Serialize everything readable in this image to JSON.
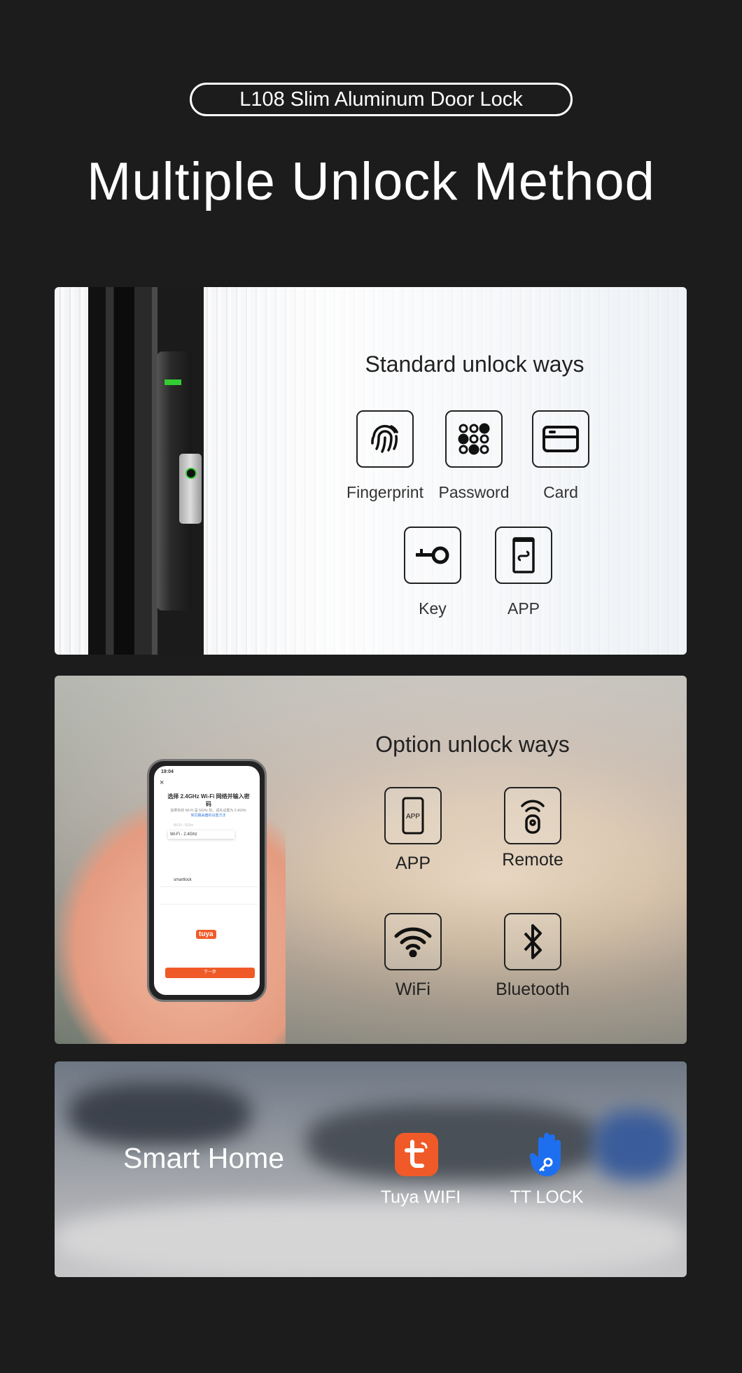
{
  "header": {
    "badge": "L108 Slim Aluminum Door Lock",
    "title": "Multiple Unlock Method"
  },
  "standard": {
    "heading": "Standard unlock ways",
    "items": [
      {
        "label": "Fingerprint",
        "icon": "fingerprint-icon"
      },
      {
        "label": "Password",
        "icon": "keypad-icon"
      },
      {
        "label": "Card",
        "icon": "card-icon"
      },
      {
        "label": "Key",
        "icon": "key-icon"
      },
      {
        "label": "APP",
        "icon": "phone-app-icon"
      }
    ]
  },
  "option": {
    "heading": "Option unlock ways",
    "items": [
      {
        "label": "APP",
        "icon": "app-icon",
        "icon_text": "APP"
      },
      {
        "label": "Remote",
        "icon": "remote-icon"
      },
      {
        "label": "WiFi",
        "icon": "wifi-icon"
      },
      {
        "label": "Bluetooth",
        "icon": "bluetooth-icon"
      }
    ],
    "phone": {
      "time": "19:04",
      "title": "选择 2.4GHz Wi-Fi 网络并输入密码",
      "subtitle": "如果你的 Wi-Fi 是 5GHz 的，请先设置为 2.4GHz",
      "link": "常见路由器的设置方法",
      "wifi_5g": "Wi-Fi - 5Ghz",
      "wifi_24": "Wi-Fi - 2.4Ghz",
      "ssid": "smartlock",
      "logo": "tuya",
      "next": "下一步"
    }
  },
  "smart_home": {
    "heading": "Smart Home",
    "apps": [
      {
        "label": "Tuya WIFI",
        "icon": "tuya-icon",
        "color": "#f05a28"
      },
      {
        "label": "TT LOCK",
        "icon": "ttlock-hand-icon",
        "color": "#1e6ff0"
      }
    ]
  }
}
